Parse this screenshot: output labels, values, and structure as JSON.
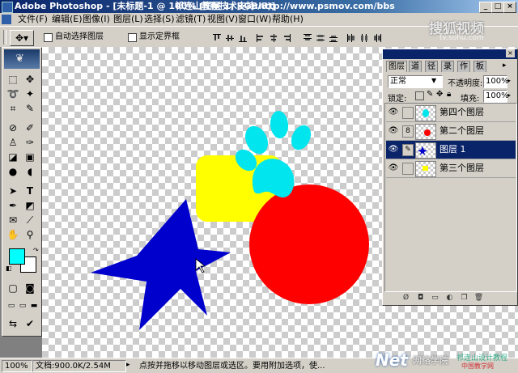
{
  "window": {
    "title": "Adobe Photoshop - [未标题-1 @ 100% (图层 1, RGB/8)]",
    "overlay_text": "祁连山教程技术支持:http://www.psmov.com/bbs"
  },
  "menu": [
    "文件(F)",
    "编辑(E)",
    "图像(I)",
    "图层(L)",
    "选择(S)",
    "滤镜(T)",
    "视图(V)",
    "窗口(W)",
    "帮助(H)"
  ],
  "options": {
    "auto_select_label": "自动选择图层",
    "show_bounds_label": "显示定界框"
  },
  "layers_panel": {
    "tabs": [
      "图层",
      "道",
      "径",
      "录",
      "作",
      "板"
    ],
    "blend_mode": "正常",
    "opacity_label": "不透明度:",
    "opacity_value": "100%",
    "lock_label": "锁定:",
    "fill_label": "填充:",
    "fill_value": "100%",
    "layers": [
      {
        "name": "第四个图层",
        "selected": false
      },
      {
        "name": "第二个图层",
        "selected": false
      },
      {
        "name": "图层 1",
        "selected": true
      },
      {
        "name": "第三个图层",
        "selected": false
      }
    ]
  },
  "status": {
    "zoom": "100%",
    "doc_info": "文档:900.0K/2.54M",
    "hint": "点按并拖移以移动图层或选区。要用附加选项，使..."
  },
  "watermarks": {
    "sohu_big": "搜狐视频",
    "sohu_small": "tv.sohu.com",
    "net": "Net",
    "net_school": "网络学院",
    "site1": "祁连山设计教程",
    "site2": "中国教学网"
  },
  "colors": {
    "foreground": "#00ffff",
    "background": "#ffffff",
    "star": "#0000cc",
    "circle": "#ff0000",
    "rect": "#ffff00",
    "paw": "#00e5ee",
    "selection": "#0a246a"
  }
}
